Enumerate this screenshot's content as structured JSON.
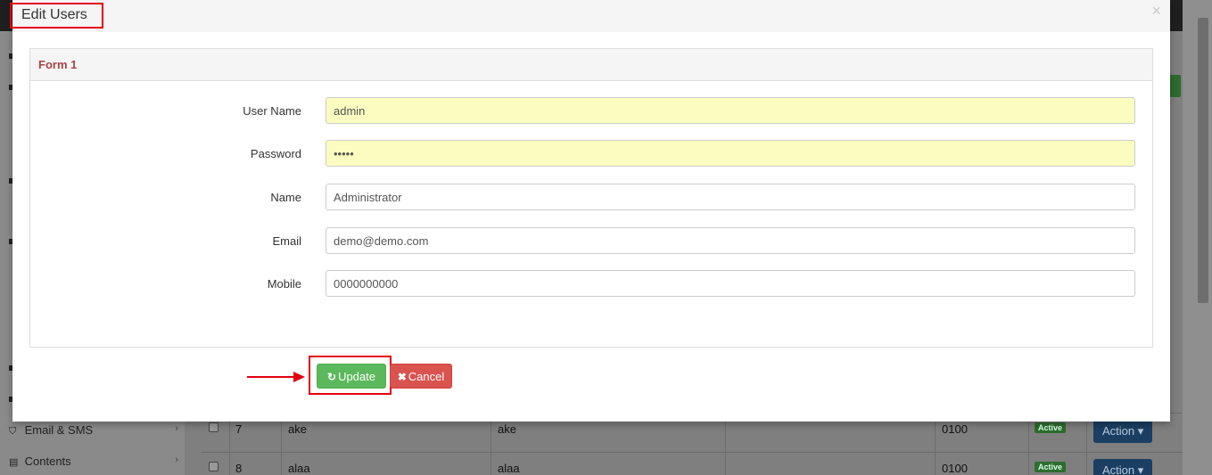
{
  "modal": {
    "title": "Edit Users",
    "close_glyph": "×",
    "panel_title": "Form 1",
    "fields": [
      {
        "label": "User Name",
        "value": "admin"
      },
      {
        "label": "Password",
        "value": "•••••"
      },
      {
        "label": "Name",
        "value": "Administrator"
      },
      {
        "label": "Email",
        "value": "demo@demo.com"
      },
      {
        "label": "Mobile",
        "value": "0000000000"
      }
    ],
    "update_button": {
      "icon": "refresh-icon",
      "glyph": "↻",
      "label": "Update"
    },
    "cancel_button": {
      "icon": "times-icon",
      "glyph": "✖",
      "label": "Cancel"
    }
  },
  "background": {
    "sidebar": [
      {
        "icon": "shield-icon",
        "glyph": "⛉",
        "label": "Email & SMS",
        "chevron": "›"
      },
      {
        "icon": "newspaper-icon",
        "glyph": "▤",
        "label": "Contents",
        "chevron": "›"
      }
    ],
    "rows": [
      {
        "id": "7",
        "username": "ake",
        "name": "ake",
        "mobile": "0100",
        "status": "Active",
        "action": "Action ▾"
      },
      {
        "id": "8",
        "username": "alaa",
        "name": "alaa",
        "mobile": "0100",
        "status": "Active",
        "action": "Action ▾"
      }
    ]
  },
  "colors": {
    "highlight": "#e3000f",
    "update_green": "#5cb85c",
    "cancel_red": "#d9534f",
    "panel_title": "#a94442",
    "autofill": "#fbfdc0"
  }
}
